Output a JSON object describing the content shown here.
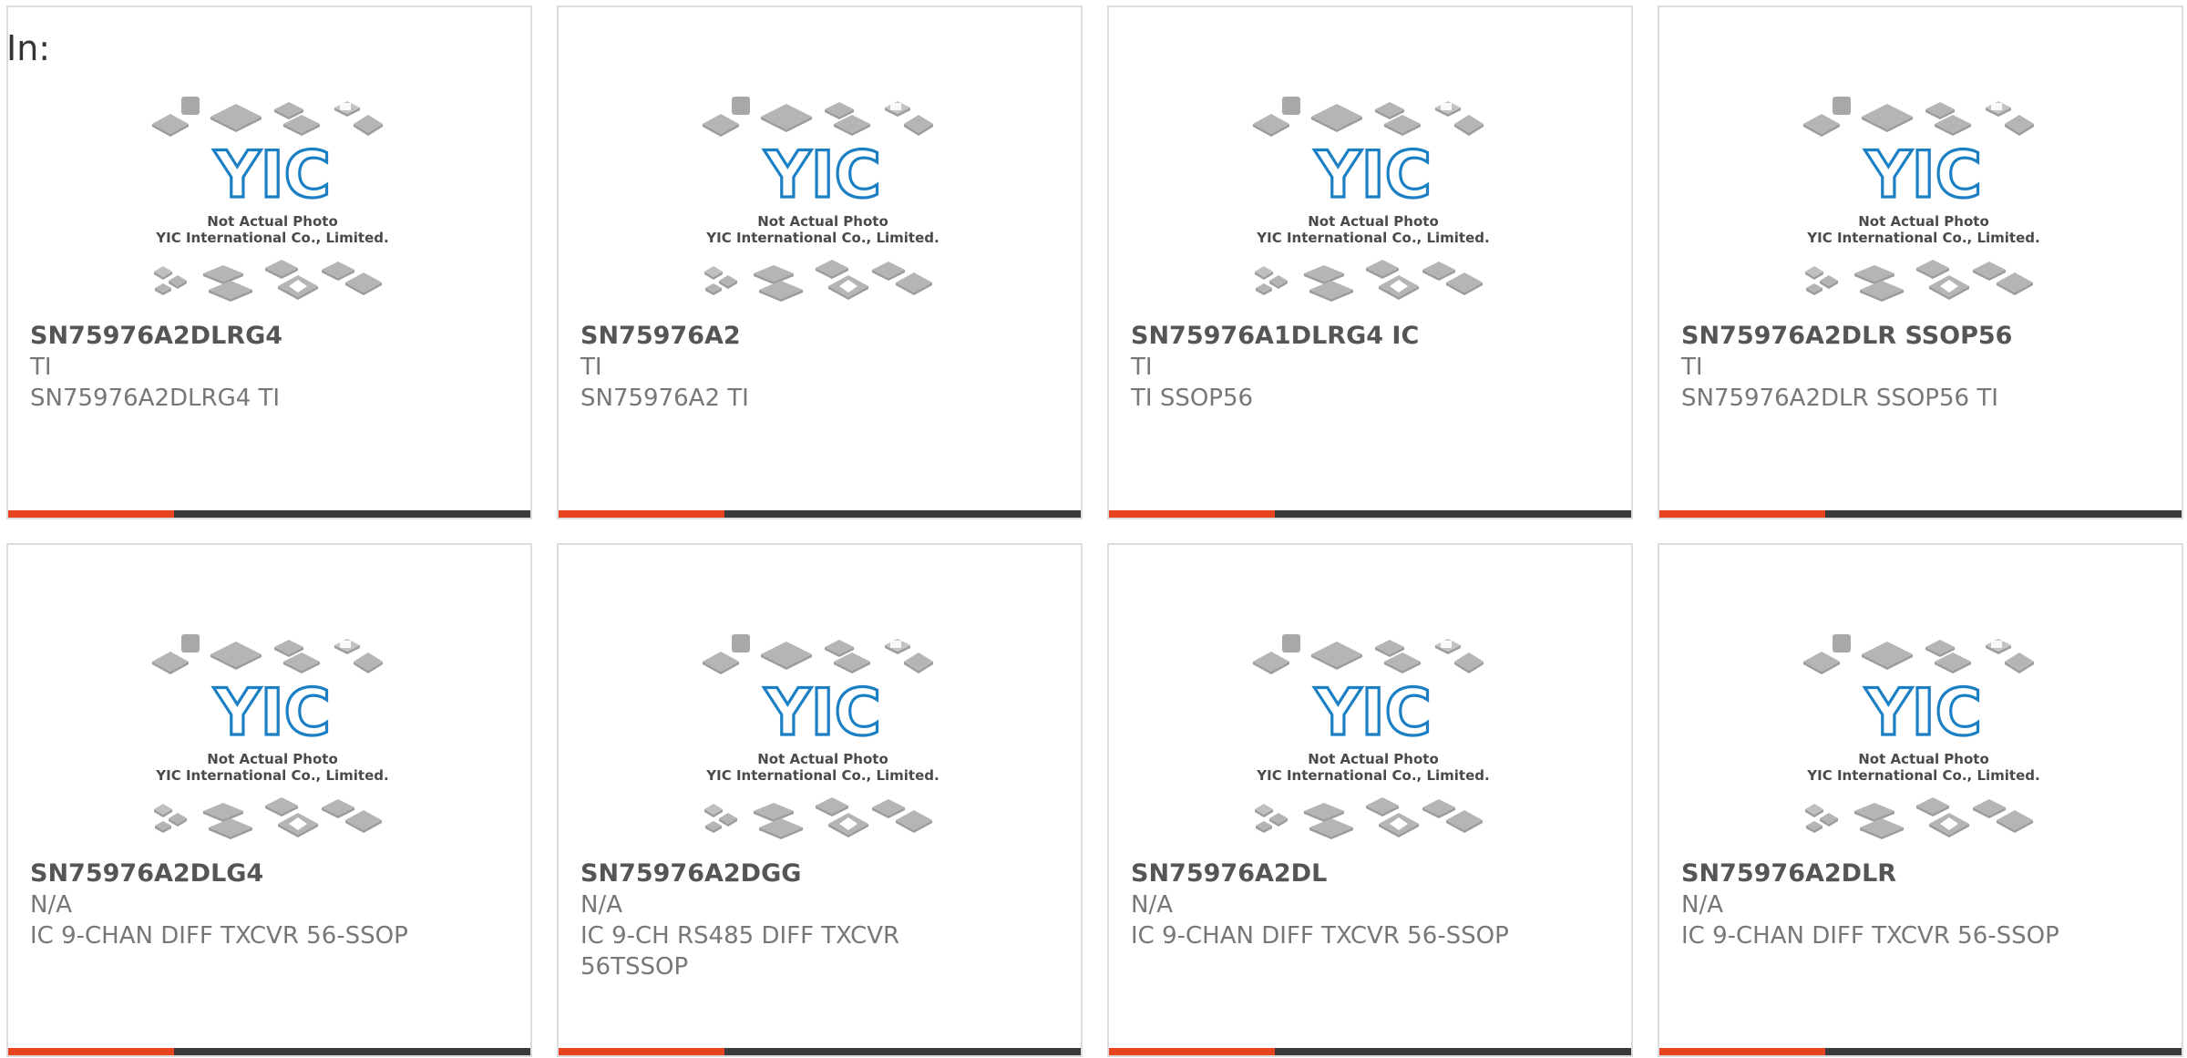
{
  "page_label": "In:",
  "colors": {
    "accent": "#e8441f",
    "bar": "#3a3a3a",
    "border": "#dcdcdc",
    "logo_blue": "#1b7fc4",
    "chip_gray": "#b5b5b5"
  },
  "placeholder_image": {
    "icon": "chip-placeholder-icon",
    "line1": "Not Actual Photo",
    "line2": "YIC International Co., Limited.",
    "logo_text": "YIC"
  },
  "products": [
    {
      "title": "SN75976A2DLRG4",
      "brand": "TI",
      "desc": "SN75976A2DLRG4 TI"
    },
    {
      "title": "SN75976A2",
      "brand": "TI",
      "desc": "SN75976A2 TI"
    },
    {
      "title": "SN75976A1DLRG4 IC",
      "brand": "TI",
      "desc": "TI SSOP56"
    },
    {
      "title": "SN75976A2DLR SSOP56",
      "brand": "TI",
      "desc": "SN75976A2DLR SSOP56 TI"
    },
    {
      "title": "SN75976A2DLG4",
      "brand": "N/A",
      "desc": "IC 9-CHAN DIFF TXCVR 56-SSOP"
    },
    {
      "title": "SN75976A2DGG",
      "brand": "N/A",
      "desc": "IC 9-CH RS485 DIFF TXCVR 56TSSOP"
    },
    {
      "title": "SN75976A2DL",
      "brand": "N/A",
      "desc": "IC 9-CHAN DIFF TXCVR 56-SSOP"
    },
    {
      "title": "SN75976A2DLR",
      "brand": "N/A",
      "desc": "IC 9-CHAN DIFF TXCVR 56-SSOP"
    }
  ]
}
